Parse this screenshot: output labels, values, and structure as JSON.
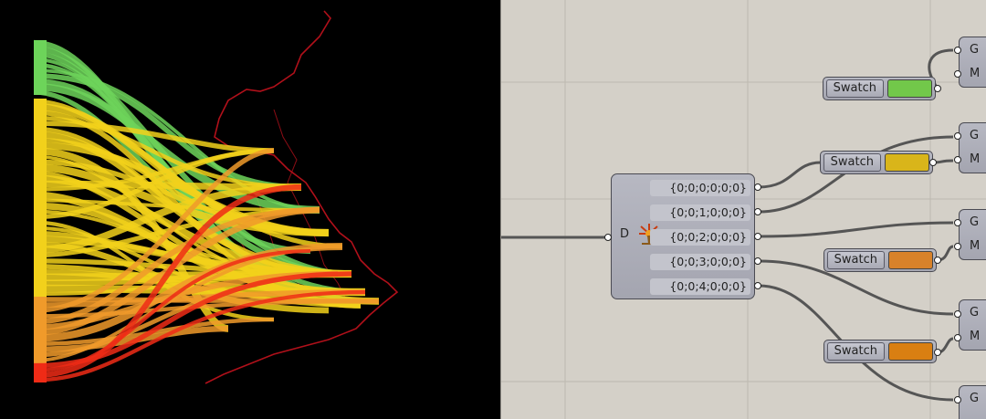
{
  "viewport": {
    "background": "#000000",
    "flow_colors": [
      "#6dd45a",
      "#f2d11b",
      "#f09a2a",
      "#ef2b16"
    ],
    "map_color": "#b0101a"
  },
  "canvas": {
    "background": "#d4d0c8",
    "splitter": {
      "input_label": "D",
      "icon": "tree-explode-icon",
      "outputs": [
        "{0;0;0;0;0;0}",
        "{0;0;1;0;0;0}",
        "{0;0;2;0;0;0}",
        "{0;0;3;0;0;0}",
        "{0;0;4;0;0;0}"
      ]
    },
    "swatches": [
      {
        "label": "Swatch",
        "color": "#72c84a"
      },
      {
        "label": "Swatch",
        "color": "#d9b51a"
      },
      {
        "label": "Swatch",
        "color": "#d8822a"
      },
      {
        "label": "Swatch",
        "color": "#d97f12"
      }
    ],
    "gm_components": [
      {
        "g": "G",
        "m": "M"
      },
      {
        "g": "G",
        "m": "M"
      },
      {
        "g": "G",
        "m": "M"
      },
      {
        "g": "G",
        "m": "M"
      },
      {
        "g": "G",
        "m": ""
      }
    ]
  }
}
